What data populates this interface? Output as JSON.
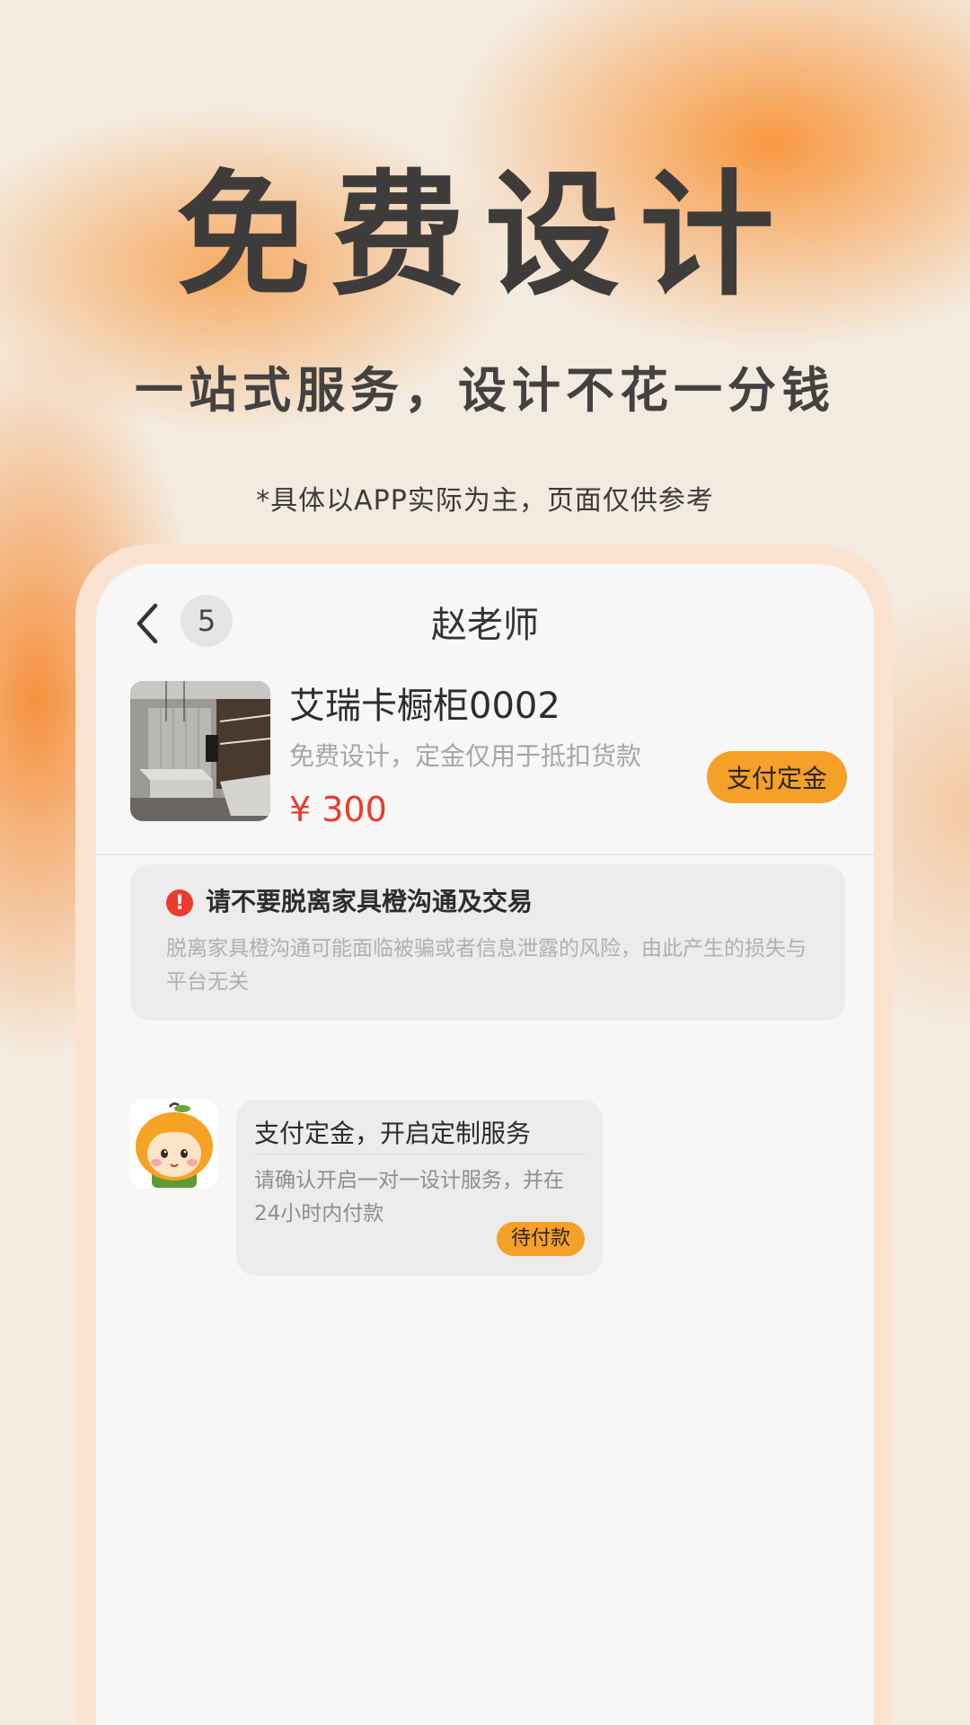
{
  "hero": {
    "title": "免费设计",
    "subtitle": "一站式服务，设计不花一分钱",
    "note": "*具体以APP实际为主，页面仅供参考"
  },
  "chat": {
    "header": {
      "back_icon": "chevron-left-icon",
      "unread_count": "5",
      "title": "赵老师"
    },
    "product": {
      "name": "艾瑞卡橱柜0002",
      "description": "免费设计，定金仅用于抵扣货款",
      "price": "¥ 300",
      "pay_button": "支付定金"
    },
    "warning": {
      "icon": "exclamation-icon",
      "title": "请不要脱离家具橙沟通及交易",
      "text": "脱离家具橙沟通可能面临被骗或者信息泄露的风险，由此产生的损失与平台无关"
    },
    "message": {
      "avatar": "orange-mascot-avatar",
      "title": "支付定金，开启定制服务",
      "text": "请确认开启一对一设计服务，并在24小时内付款",
      "status": "待付款"
    }
  },
  "colors": {
    "accent": "#f5a027",
    "price": "#ec3b2a",
    "warning": "#ee3a2e",
    "background_orange": "#f78a26"
  }
}
